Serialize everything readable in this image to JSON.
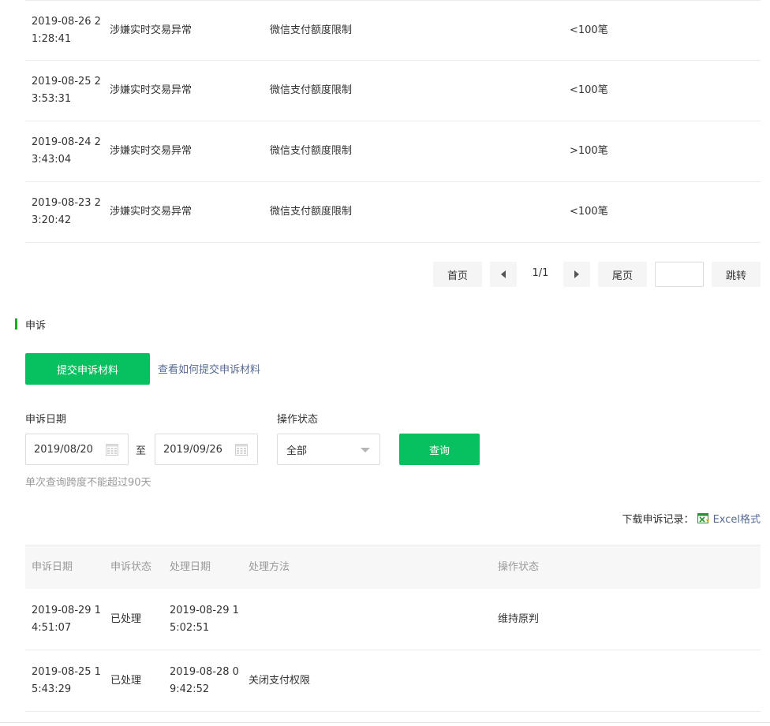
{
  "records": [
    {
      "time": "2019-08-26 21:28:41",
      "reason": "涉嫌实时交易异常",
      "limit": "微信支付额度限制",
      "count": "<100笔"
    },
    {
      "time": "2019-08-25 23:53:31",
      "reason": "涉嫌实时交易异常",
      "limit": "微信支付额度限制",
      "count": "<100笔"
    },
    {
      "time": "2019-08-24 23:43:04",
      "reason": "涉嫌实时交易异常",
      "limit": "微信支付额度限制",
      "count": ">100笔"
    },
    {
      "time": "2019-08-23 23:20:42",
      "reason": "涉嫌实时交易异常",
      "limit": "微信支付额度限制",
      "count": "<100笔"
    }
  ],
  "pager": {
    "first": "首页",
    "info": "1/1",
    "last": "尾页",
    "jump": "跳转",
    "input_value": ""
  },
  "appeal": {
    "section_title": "申诉",
    "submit_label": "提交申诉材料",
    "howto_link": "查看如何提交申诉材料",
    "date_label": "申诉日期",
    "status_label": "操作状态",
    "start_date": "2019/08/20",
    "to_text": "至",
    "end_date": "2019/09/26",
    "status_selected": "全部",
    "query_label": "查询",
    "hint": "单次查询跨度不能超过90天",
    "download_label": "下载申诉记录：",
    "download_link": "Excel格式",
    "table": {
      "headers": [
        "申诉日期",
        "申诉状态",
        "处理日期",
        "处理方法",
        "操作状态"
      ],
      "rows": [
        {
          "date": "2019-08-29 14:51:07",
          "state": "已处理",
          "pdate": "2019-08-29 15:02:51",
          "method": "",
          "op": "维持原判"
        },
        {
          "date": "2019-08-25 15:43:29",
          "state": "已处理",
          "pdate": "2019-08-28 09:42:52",
          "method": "关闭支付权限",
          "op": ""
        }
      ]
    }
  },
  "colors": {
    "accent": "#07c160",
    "link": "#576b95",
    "section_bar": "#1aad19"
  }
}
